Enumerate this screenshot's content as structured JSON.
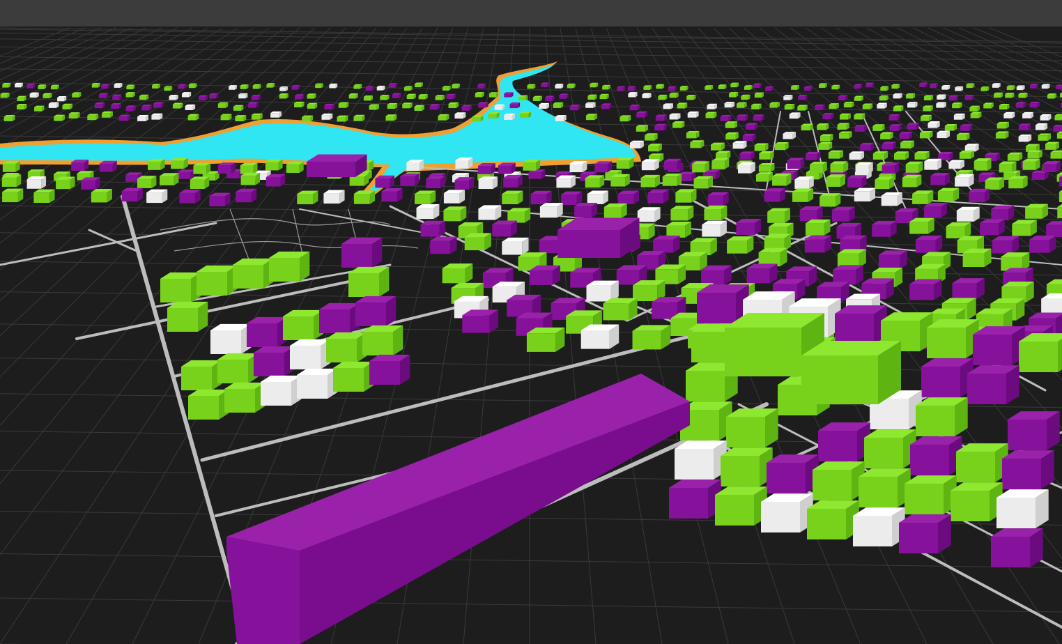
{
  "viewport": {
    "type": "3d-city-scene",
    "background_color": "#3c3c3c",
    "ground_color": "#1d1d1d",
    "grid_color": "#3a3a3a",
    "road_color": "#bdbdbd",
    "water_color": "#2fe6f2",
    "shore_color": "#f0a030"
  },
  "building_colors": {
    "green": {
      "top": "#8ee830",
      "left": "#78d21c",
      "right": "#5eb410"
    },
    "purple": {
      "top": "#9a22aa",
      "left": "#86119a",
      "right": "#6c0a80"
    },
    "white": {
      "top": "#ffffff",
      "left": "#ececec",
      "right": "#cfcfcf"
    }
  }
}
